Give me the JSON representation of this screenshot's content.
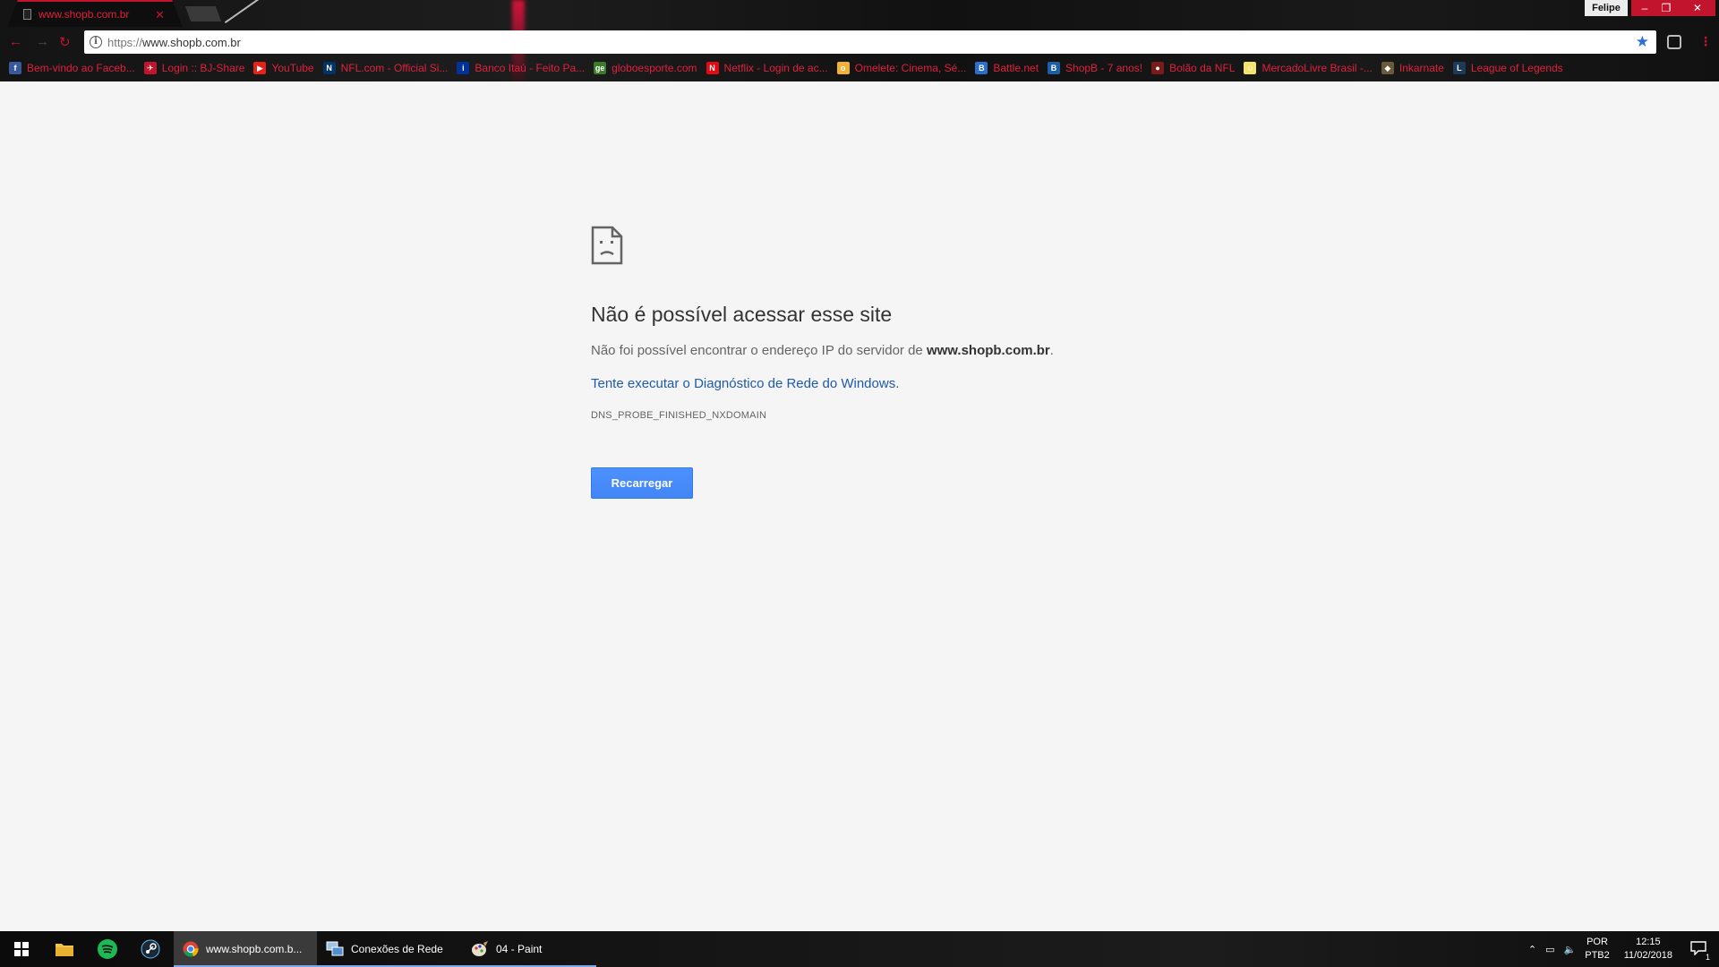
{
  "window": {
    "profile_name": "Felipe",
    "minimize": "–",
    "maximize": "❐",
    "close": "✕"
  },
  "tab": {
    "title": "www.shopb.com.br",
    "close": "✕"
  },
  "toolbar": {
    "back": "←",
    "forward": "→",
    "reload": "↻",
    "url_scheme": "https://",
    "url_host": "www.shopb.com.br",
    "star": "★",
    "menu": "⋮"
  },
  "bookmarks": [
    {
      "label": "Bem-vindo ao Faceb...",
      "icon": "facebook-icon",
      "color": "#3b5998",
      "glyph": "f"
    },
    {
      "label": "Login :: BJ-Share",
      "icon": "bj-share-icon",
      "color": "#c3142e",
      "glyph": "✈"
    },
    {
      "label": "YouTube",
      "icon": "youtube-icon",
      "color": "#e62117",
      "glyph": "▶"
    },
    {
      "label": "NFL.com - Official Si...",
      "icon": "nfl-icon",
      "color": "#013369",
      "glyph": "N"
    },
    {
      "label": "Banco Itaú - Feito Pa...",
      "icon": "itau-icon",
      "color": "#003399",
      "glyph": "i"
    },
    {
      "label": "globoesporte.com",
      "icon": "globoesporte-icon",
      "color": "#3a7a2a",
      "glyph": "ge"
    },
    {
      "label": "Netflix - Login de ac...",
      "icon": "netflix-icon",
      "color": "#e50914",
      "glyph": "N"
    },
    {
      "label": "Omelete: Cinema, Sé...",
      "icon": "omelete-icon",
      "color": "#f2b233",
      "glyph": "o"
    },
    {
      "label": "Battle.net",
      "icon": "battlenet-icon",
      "color": "#2a6fc9",
      "glyph": "B"
    },
    {
      "label": "ShopB - 7 anos!",
      "icon": "shopb-icon",
      "color": "#1c5fa8",
      "glyph": "B"
    },
    {
      "label": "Bolão da NFL",
      "icon": "bolao-icon",
      "color": "#7a1a1a",
      "glyph": "●"
    },
    {
      "label": "MercadoLivre Brasil -...",
      "icon": "mercadolivre-icon",
      "color": "#f5e36b",
      "glyph": "☺"
    },
    {
      "label": "Inkarnate",
      "icon": "inkarnate-icon",
      "color": "#6b5a3a",
      "glyph": "◆"
    },
    {
      "label": "League of Legends",
      "icon": "lol-icon",
      "color": "#1e3a5a",
      "glyph": "L"
    }
  ],
  "bookmarks_more": "»",
  "error": {
    "title": "Não é possível acessar esse site",
    "desc_prefix": "Não foi possível encontrar o endereço IP do servidor de ",
    "desc_host": "www.shopb.com.br",
    "desc_suffix": ".",
    "diag_link": "Tente executar o Diagnóstico de Rede do Windows.",
    "code": "DNS_PROBE_FINISHED_NXDOMAIN",
    "reload_button": "Recarregar"
  },
  "taskbar": {
    "apps": [
      {
        "label": "www.shopb.com.b...",
        "icon": "chrome-icon",
        "active": true
      },
      {
        "label": "Conexões de Rede",
        "icon": "network-connections-icon",
        "active": false
      },
      {
        "label": "04 - Paint",
        "icon": "paint-icon",
        "active": false
      }
    ],
    "lang_top": "POR",
    "lang_bottom": "PTB2",
    "time": "12:15",
    "date": "11/02/2018",
    "notifications": "1"
  },
  "colors": {
    "accent": "#c3142e",
    "link": "#1e5aa8",
    "button": "#4285f4"
  }
}
